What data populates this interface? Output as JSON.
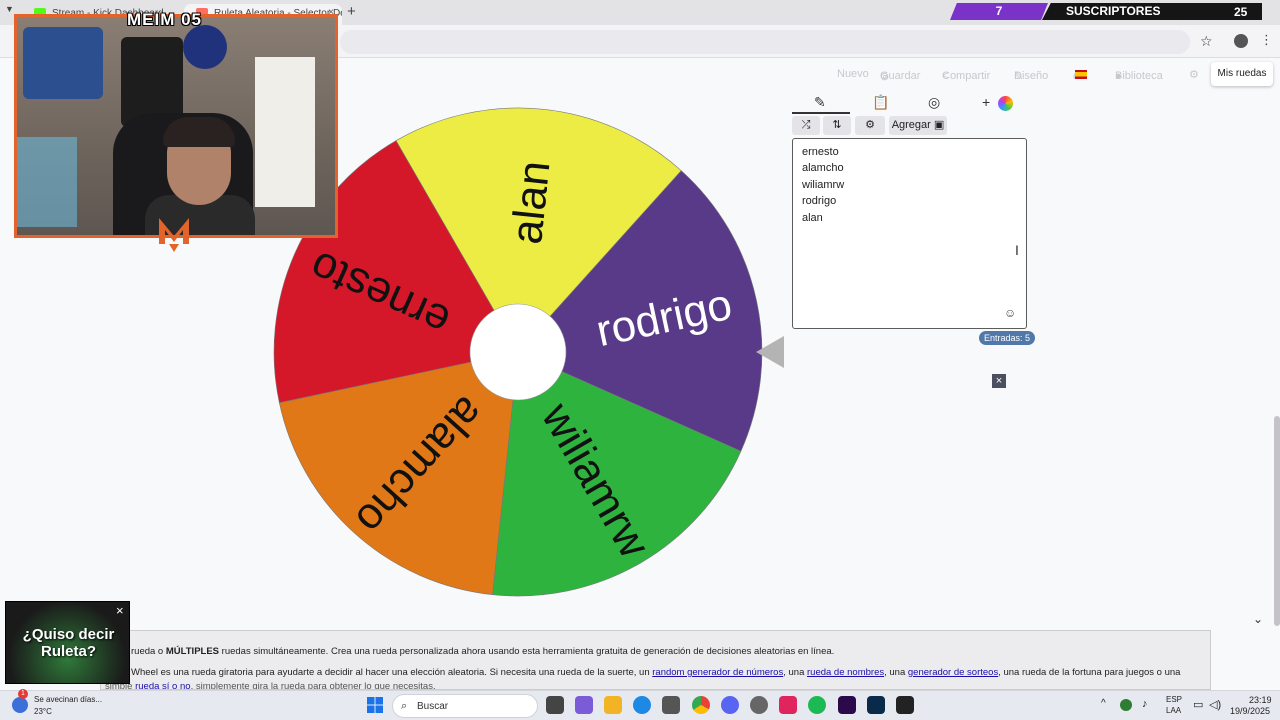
{
  "browser": {
    "tabs": [
      {
        "label": "Stream - Kick Dashboard",
        "favicon_color": "#53fc18"
      },
      {
        "label": "Ruleta Aleatoria - Selector De...",
        "favicon_color": "#ff6f61"
      }
    ],
    "new_tab": "+",
    "close": "×"
  },
  "stream_overlay": {
    "channel_name": "MEIM 05",
    "subs_count": "7",
    "subs_label": "SUSCRIPTORES",
    "subs_goal": "25",
    "promo_text": "¿Quiso decir Ruleta?",
    "promo_close": "×"
  },
  "toolbar": {
    "new": "Nuevo",
    "save": "Guardar",
    "share": "Compartir",
    "design": "Diseño",
    "lang": "es",
    "library": "Biblioteca",
    "my_wheels": "Mis ruedas"
  },
  "wheel": {
    "segments": [
      {
        "label": "alan",
        "color": "#ecec45"
      },
      {
        "label": "rodrigo",
        "color": "#593a88"
      },
      {
        "label": "wiliamrw",
        "color": "#2eb43e"
      },
      {
        "label": "alamcho",
        "color": "#e07818"
      },
      {
        "label": "ernesto",
        "color": "#d4182a"
      }
    ]
  },
  "editor": {
    "add_image_label": "Agregar",
    "entries": [
      "ernesto",
      "alamcho",
      "wiliamrw",
      "rodrigo",
      "alan"
    ],
    "entries_count": "Entradas: 5"
  },
  "description": {
    "line1_prefix": "rueda o ",
    "line1_bold": "MÚLTIPLES",
    "line1_suffix": " ruedas simultáneamente. Crea una rueda personalizada ahora usando esta herramienta gratuita de generación de decisiones aleatorias en línea.",
    "line2_a": "Wheel es una rueda giratoria para ayudarte a decidir al hacer una elección aleatoria. Si necesita una rueda de la suerte, un ",
    "link1": "random generador de números",
    "line2_b": ", una ",
    "link2": "rueda de nombres",
    "line2_c": ", una ",
    "link3": "generador de sorteos",
    "line2_d": ", una rueda de la fortuna para juegos o una",
    "line3_a": "simple ",
    "link4": "rueda sí o no",
    "line3_b": ", simplemente gira la rueda para obtener lo que necesitas."
  },
  "taskbar": {
    "weather_text": "Se avecinan días...",
    "weather_temp": "23°C",
    "search_placeholder": "Buscar",
    "lang_line1": "ESP",
    "lang_line2": "LAA",
    "time": "23:19",
    "date": "19/9/2025",
    "notification_badge": "1"
  }
}
